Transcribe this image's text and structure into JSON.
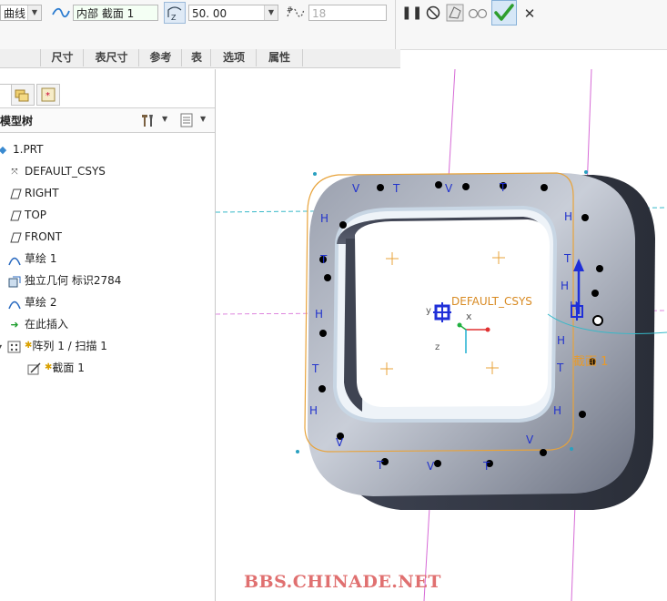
{
  "toolbar": {
    "curve_type": "曲线",
    "section_icon": "section-trajectory-icon",
    "section_select": "内部 截面 1",
    "value_input": "50. 00",
    "dim_input": "18",
    "pause_icon": "pause-icon",
    "no_preview_icon": "no-preview-icon",
    "mesh_preview_icon": "mesh-preview-icon",
    "glasses_icon": "verify-preview-icon",
    "ok_icon": "checkmark-icon",
    "cancel_icon": "close-icon"
  },
  "tabs": [
    "尺寸",
    "表尺寸",
    "参考",
    "表",
    "选项",
    "属性"
  ],
  "model_tree": {
    "title": "模型树",
    "items": [
      {
        "label": "1.PRT",
        "icon": "part-icon"
      },
      {
        "label": "DEFAULT_CSYS",
        "icon": "csys-icon"
      },
      {
        "label": "RIGHT",
        "icon": "datum-plane-icon"
      },
      {
        "label": "TOP",
        "icon": "datum-plane-icon"
      },
      {
        "label": "FRONT",
        "icon": "datum-plane-icon"
      },
      {
        "label": "草绘 1",
        "icon": "sketch-icon"
      },
      {
        "label": "独立几何 标识2784",
        "icon": "independent-geometry-icon"
      },
      {
        "label": "草绘 2",
        "icon": "sketch-icon"
      },
      {
        "label": "在此插入",
        "icon": "insert-arrow-icon"
      },
      {
        "label": "阵列 1 / 扫描 1",
        "icon": "pattern-icon"
      },
      {
        "label": "截面 1",
        "icon": "section-icon"
      }
    ]
  },
  "canvas": {
    "csys_label": "DEFAULT_CSYS",
    "section_label": "截面 1",
    "axis_x": "x",
    "axis_y": "y",
    "axis_z": "z",
    "constraint_labels": [
      "V",
      "T",
      "V",
      "T",
      "H",
      "H",
      "T",
      "H",
      "H",
      "T",
      "H",
      "H",
      "T",
      "H",
      "V",
      "T",
      "V",
      "T",
      "V",
      "T",
      "H"
    ]
  },
  "watermark": "BBS.CHINADE.NET",
  "colors": {
    "solid_dark": "#4a4f5e",
    "solid_light": "#d8dce6",
    "trajectory": "#e8a33a",
    "datum_plane": "#d66ad6",
    "datum_axis_cyan": "#36b8c8",
    "constraint_text": "#2233cc",
    "ok_green": "#2e9e2e"
  }
}
